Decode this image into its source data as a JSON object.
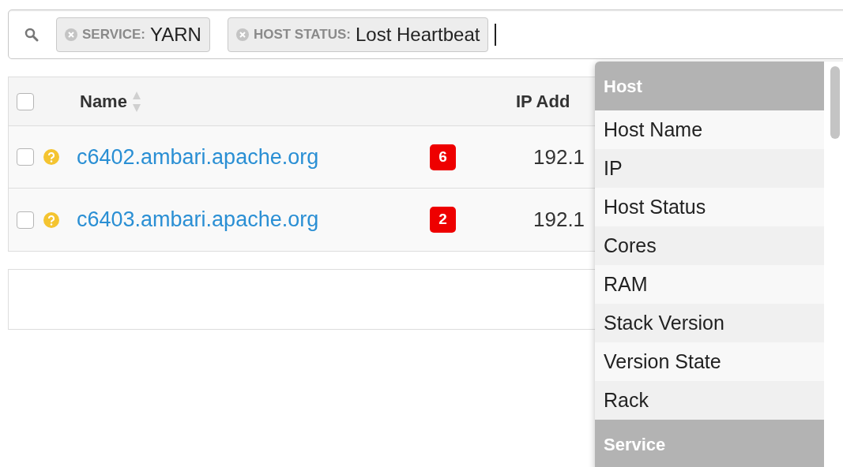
{
  "search": {
    "chips": [
      {
        "label": "SERVICE:",
        "value": "YARN"
      },
      {
        "label": "HOST STATUS:",
        "value": "Lost Heartbeat"
      }
    ]
  },
  "table": {
    "select_all_checked": false,
    "columns": [
      "Name",
      "IP Add"
    ],
    "rows": [
      {
        "checked": false,
        "name": "c6402.ambari.apache.org",
        "alerts": "6",
        "ip": "192.1"
      },
      {
        "checked": false,
        "name": "c6403.ambari.apache.org",
        "alerts": "2",
        "ip": "192.1"
      }
    ]
  },
  "dropdown": {
    "groups": [
      {
        "title": "Host",
        "items": [
          "Host Name",
          "IP",
          "Host Status",
          "Cores",
          "RAM",
          "Stack Version",
          "Version State",
          "Rack"
        ]
      },
      {
        "title": "Service"
      }
    ]
  }
}
